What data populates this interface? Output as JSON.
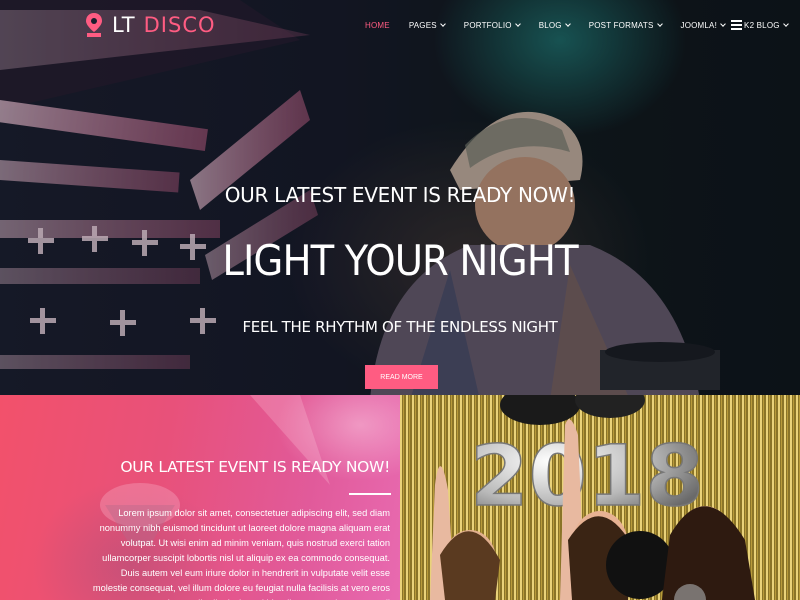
{
  "brand": {
    "logo_prefix": "LT",
    "logo_name": "DISCO",
    "accent_color": "#ff5c82"
  },
  "nav": {
    "items": [
      {
        "label": "HOME",
        "active": true,
        "dropdown": false
      },
      {
        "label": "PAGES",
        "active": false,
        "dropdown": true
      },
      {
        "label": "PORTFOLIO",
        "active": false,
        "dropdown": true
      },
      {
        "label": "BLOG",
        "active": false,
        "dropdown": true
      },
      {
        "label": "POST FORMATS",
        "active": false,
        "dropdown": true
      },
      {
        "label": "JOOMLA!",
        "active": false,
        "dropdown": true
      },
      {
        "label": "K2 BLOG",
        "active": false,
        "dropdown": true
      }
    ],
    "menu_icon": "hamburger-icon"
  },
  "hero": {
    "subtitle": "OUR LATEST EVENT IS READY NOW!",
    "title": "LIGHT YOUR NIGHT",
    "tagline": "FEEL THE RHYTHM OF THE ENDLESS NIGHT",
    "button_label": "READ MORE"
  },
  "event": {
    "title": "OUR LATEST EVENT IS READY NOW!",
    "body": "Lorem ipsum dolor sit amet, consectetuer adipiscing elit, sed diam nonummy nibh euismod tincidunt ut laoreet dolore magna aliquam erat volutpat. Ut wisi enim ad minim veniam, quis nostrud exerci tation ullamcorper suscipit lobortis nisl ut aliquip ex ea commodo consequat. Duis autem vel eum iriure dolor in hendrerit in vulputate velit esse molestie consequat, vel illum dolore eu feugiat nulla facilisis at vero eros et accumsan et iusto odio dignissim qui blandit praesent luptatum zzril"
  },
  "party_photo": {
    "balloon_text": "2018"
  }
}
